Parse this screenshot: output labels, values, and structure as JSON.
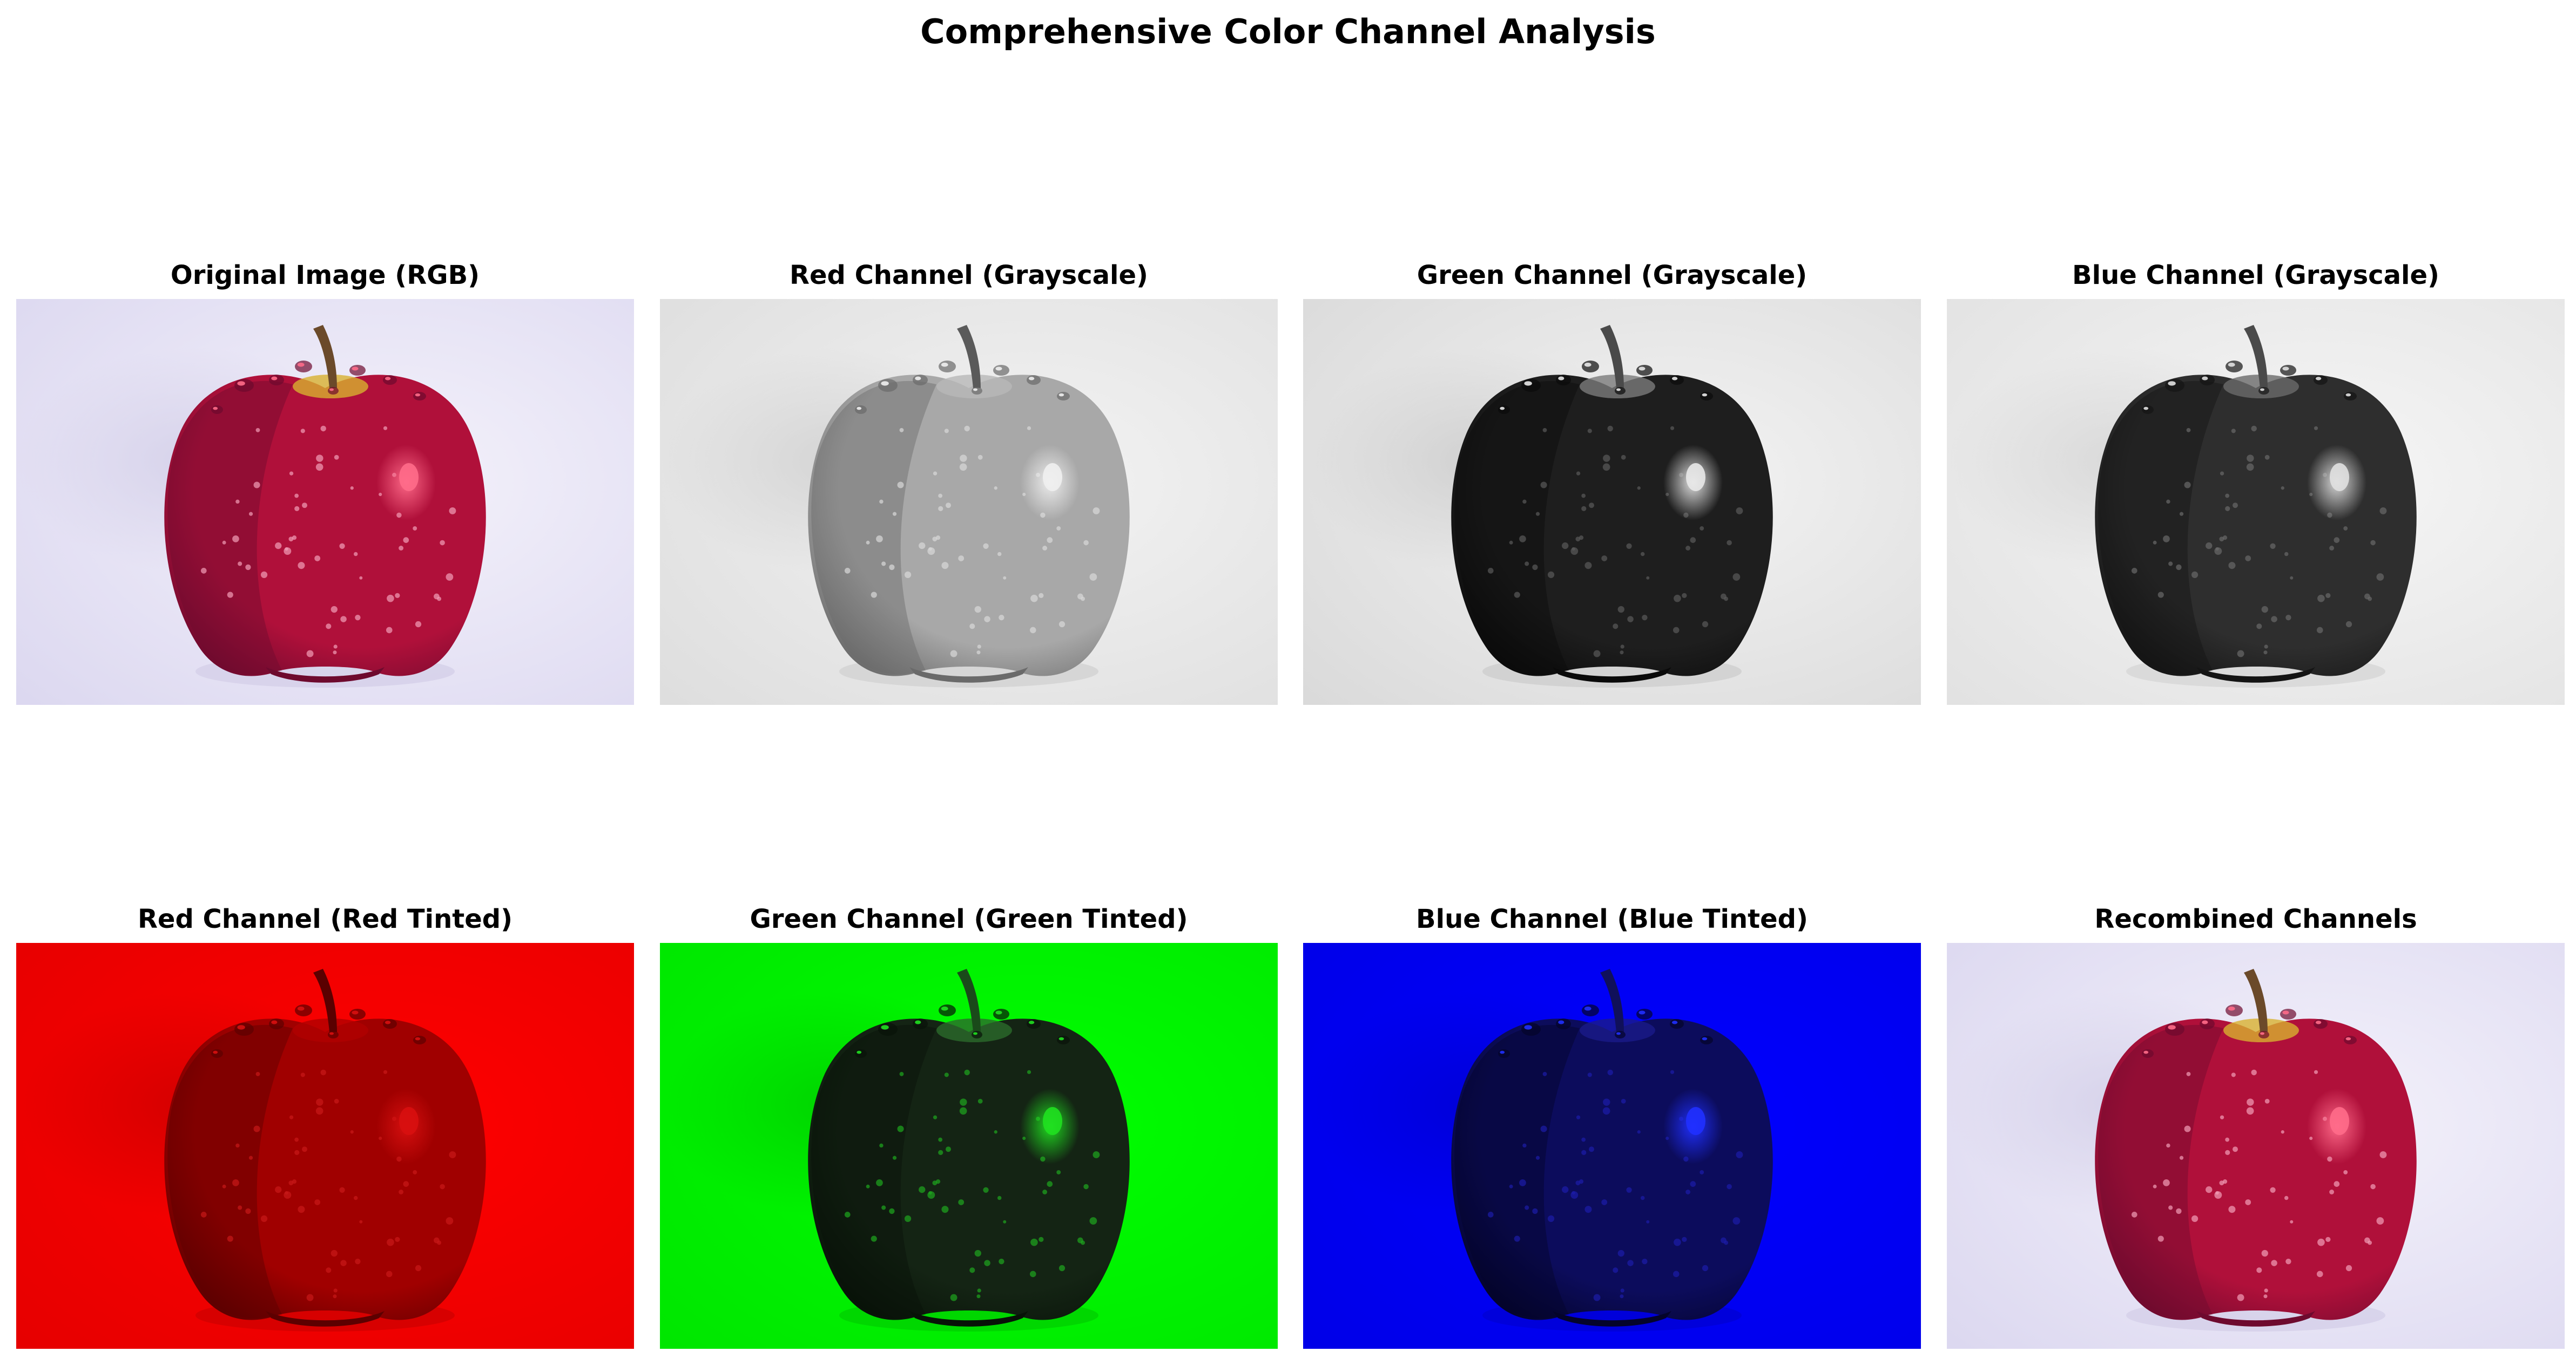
{
  "figure": {
    "title": "Comprehensive Color Channel Analysis"
  },
  "panels": [
    {
      "title": "Original Image (RGB)",
      "mode": "rgb",
      "colors": {
        "bg": "#f4f2fb",
        "bg_edge": "#dcd8f0",
        "shadow": "#d6d2ea",
        "body": "#b0103a",
        "body_dark": "#6e0a2e",
        "highlight": "#ff6b8a",
        "stem": "#6b4a2a",
        "leaf_well": "#d8b030",
        "speck": "#f2a0b8"
      }
    },
    {
      "title": "Red Channel (Grayscale)",
      "mode": "gray",
      "colors": {
        "bg": "#f3f3f3",
        "bg_edge": "#dedede",
        "shadow": "#d4d4d4",
        "body": "#a8a8a8",
        "body_dark": "#6a6a6a",
        "highlight": "#efefef",
        "stem": "#5a5a5a",
        "leaf_well": "#b8b8b8",
        "speck": "#d8d8d8"
      }
    },
    {
      "title": "Green Channel (Grayscale)",
      "mode": "gray",
      "colors": {
        "bg": "#f3f3f3",
        "bg_edge": "#dadada",
        "shadow": "#d0d0d0",
        "body": "#1e1e1e",
        "body_dark": "#0a0a0a",
        "highlight": "#e8e8e8",
        "stem": "#4a4a4a",
        "leaf_well": "#7a7a7a",
        "speck": "#5a5a5a"
      }
    },
    {
      "title": "Blue Channel (Grayscale)",
      "mode": "gray",
      "colors": {
        "bg": "#f6f6f6",
        "bg_edge": "#e2e2e2",
        "shadow": "#d8d8d8",
        "body": "#2e2e2e",
        "body_dark": "#141414",
        "highlight": "#e0e0e0",
        "stem": "#4a4a4a",
        "leaf_well": "#6a6a6a",
        "speck": "#6a6a6a"
      }
    },
    {
      "title": "Red Channel (Red Tinted)",
      "mode": "red",
      "colors": {
        "bg": "#ff0000",
        "bg_edge": "#e60000",
        "shadow": "#d40000",
        "body": "#a00000",
        "body_dark": "#5c0000",
        "highlight": "#d81010",
        "stem": "#5a0000",
        "leaf_well": "#b00000",
        "speck": "#c81818"
      }
    },
    {
      "title": "Green Channel (Green Tinted)",
      "mode": "green",
      "colors": {
        "bg": "#00ff00",
        "bg_edge": "#00e600",
        "shadow": "#00d400",
        "body": "#142414",
        "body_dark": "#081208",
        "highlight": "#20e020",
        "stem": "#1a4a1a",
        "leaf_well": "#2a6a2a",
        "speck": "#1ea81e"
      }
    },
    {
      "title": "Blue Channel (Blue Tinted)",
      "mode": "blue",
      "colors": {
        "bg": "#0000ff",
        "bg_edge": "#0000e8",
        "shadow": "#0000d8",
        "body": "#0c0c5c",
        "body_dark": "#04042a",
        "highlight": "#2030ff",
        "stem": "#10105a",
        "leaf_well": "#1a1a8a",
        "speck": "#1c1caa"
      }
    },
    {
      "title": "Recombined Channels",
      "mode": "rgb",
      "colors": {
        "bg": "#f4f2fb",
        "bg_edge": "#dcd8f0",
        "shadow": "#d6d2ea",
        "body": "#b0103a",
        "body_dark": "#6e0a2e",
        "highlight": "#ff6b8a",
        "stem": "#6b4a2a",
        "leaf_well": "#d8b030",
        "speck": "#f2a0b8"
      }
    }
  ]
}
